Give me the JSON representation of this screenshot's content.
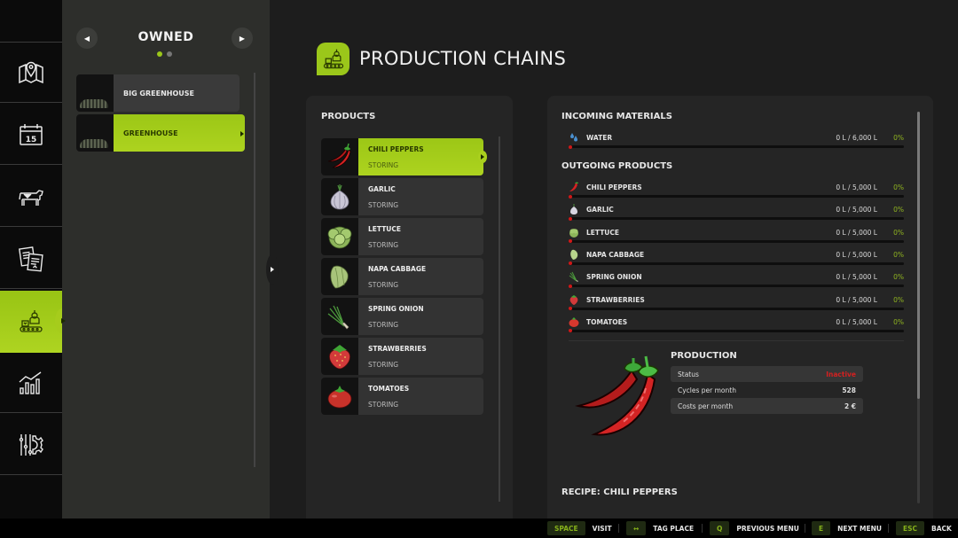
{
  "nav": {
    "tabs": [
      {
        "name": "map",
        "icon": "map-icon"
      },
      {
        "name": "calendar",
        "icon": "calendar-icon",
        "day": "15"
      },
      {
        "name": "animals",
        "icon": "cow-icon"
      },
      {
        "name": "contracts",
        "icon": "documents-icon"
      },
      {
        "name": "production",
        "icon": "production-icon",
        "active": true
      },
      {
        "name": "statistics",
        "icon": "chart-icon"
      },
      {
        "name": "settings",
        "icon": "settings-icon"
      }
    ]
  },
  "owned": {
    "title": "OWNED",
    "page_count": 2,
    "current_page": 1,
    "items": [
      {
        "label": "BIG GREENHOUSE",
        "active": false
      },
      {
        "label": "GREENHOUSE",
        "active": true
      }
    ]
  },
  "header": {
    "title": "PRODUCTION CHAINS"
  },
  "products": {
    "title": "PRODUCTS",
    "items": [
      {
        "name": "CHILI PEPPERS",
        "status": "STORING",
        "icon": "chili-icon",
        "active": true
      },
      {
        "name": "GARLIC",
        "status": "STORING",
        "icon": "garlic-icon"
      },
      {
        "name": "LETTUCE",
        "status": "STORING",
        "icon": "lettuce-icon"
      },
      {
        "name": "NAPA CABBAGE",
        "status": "STORING",
        "icon": "napa-cabbage-icon"
      },
      {
        "name": "SPRING ONION",
        "status": "STORING",
        "icon": "spring-onion-icon"
      },
      {
        "name": "STRAWBERRIES",
        "status": "STORING",
        "icon": "strawberry-icon"
      },
      {
        "name": "TOMATOES",
        "status": "STORING",
        "icon": "tomato-icon"
      }
    ]
  },
  "details": {
    "incoming_title": "INCOMING MATERIALS",
    "incoming": [
      {
        "name": "WATER",
        "amount": "0 L / 6,000 L",
        "percent": "0%",
        "fill": 0,
        "icon": "water-icon"
      }
    ],
    "outgoing_title": "OUTGOING PRODUCTS",
    "outgoing": [
      {
        "name": "CHILI PEPPERS",
        "amount": "0 L / 5,000 L",
        "percent": "0%",
        "fill": 0,
        "icon": "chili-icon"
      },
      {
        "name": "GARLIC",
        "amount": "0 L / 5,000 L",
        "percent": "0%",
        "fill": 0,
        "icon": "garlic-icon"
      },
      {
        "name": "LETTUCE",
        "amount": "0 L / 5,000 L",
        "percent": "0%",
        "fill": 0,
        "icon": "lettuce-icon"
      },
      {
        "name": "NAPA CABBAGE",
        "amount": "0 L / 5,000 L",
        "percent": "0%",
        "fill": 0,
        "icon": "napa-cabbage-icon"
      },
      {
        "name": "SPRING ONION",
        "amount": "0 L / 5,000 L",
        "percent": "0%",
        "fill": 0,
        "icon": "spring-onion-icon"
      },
      {
        "name": "STRAWBERRIES",
        "amount": "0 L / 5,000 L",
        "percent": "0%",
        "fill": 0,
        "icon": "strawberry-icon"
      },
      {
        "name": "TOMATOES",
        "amount": "0 L / 5,000 L",
        "percent": "0%",
        "fill": 0,
        "icon": "tomato-icon"
      }
    ],
    "production": {
      "title": "PRODUCTION",
      "stats": [
        {
          "label": "Status",
          "value": "Inactive",
          "state": "bad"
        },
        {
          "label": "Cycles per month",
          "value": "528"
        },
        {
          "label": "Costs per month",
          "value": "2 €"
        }
      ]
    },
    "recipe_title": "RECIPE: CHILI PEPPERS"
  },
  "colors": {
    "accent": "#9bc71a",
    "inactive": "#d42020",
    "fill_empty": "#d01818",
    "percent": "#8fb320"
  },
  "hints": [
    {
      "key": "SPACE",
      "label": "VISIT"
    },
    {
      "key": "↔",
      "label": "TAG PLACE"
    },
    {
      "key": "Q",
      "label": "PREVIOUS MENU"
    },
    {
      "key": "E",
      "label": "NEXT MENU"
    },
    {
      "key": "ESC",
      "label": "BACK"
    }
  ]
}
